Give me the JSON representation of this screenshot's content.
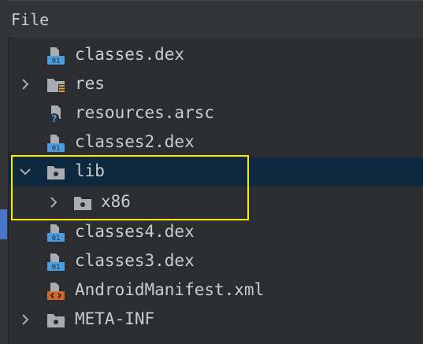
{
  "panel": {
    "title": "File"
  },
  "tree": {
    "items": [
      {
        "label": "classes.dex",
        "icon": "dex-file-icon"
      },
      {
        "label": "res",
        "icon": "folder-icon"
      },
      {
        "label": "resources.arsc",
        "icon": "unknown-file-icon"
      },
      {
        "label": "classes2.dex",
        "icon": "dex-file-icon"
      },
      {
        "label": "lib",
        "icon": "folder-icon",
        "expanded": true,
        "selected": true
      },
      {
        "label": "x86",
        "icon": "folder-icon"
      },
      {
        "label": "classes4.dex",
        "icon": "dex-file-icon"
      },
      {
        "label": "classes3.dex",
        "icon": "dex-file-icon"
      },
      {
        "label": "AndroidManifest.xml",
        "icon": "xml-file-icon"
      },
      {
        "label": "META-INF",
        "icon": "folder-icon"
      }
    ],
    "dex_badge": "01"
  },
  "colors": {
    "background": "#2b2d30",
    "selection": "#0e293f",
    "highlight_box": "#f6ec00",
    "dex_blue": "#4a9ee0",
    "xml_orange": "#d0682d"
  }
}
